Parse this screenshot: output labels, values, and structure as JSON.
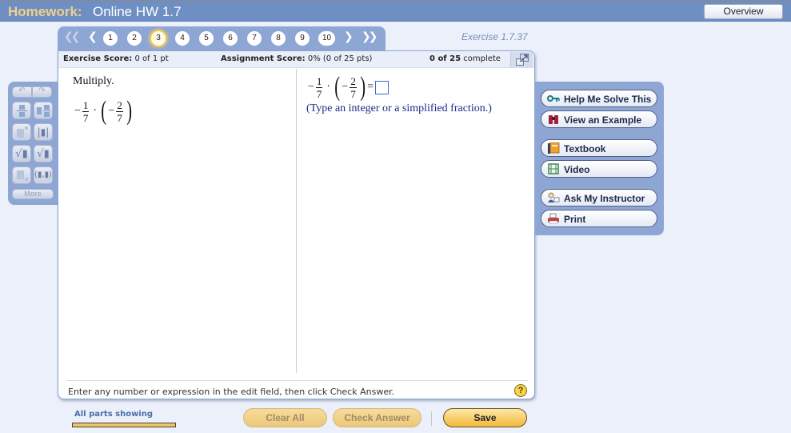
{
  "header": {
    "section_label": "Homework:",
    "assignment_title": "Online HW 1.7",
    "overview_button": "Overview"
  },
  "exercise_label": "Exercise 1.7.37",
  "navigation": {
    "first_icon": "double-chevron-left-icon",
    "prev_icon": "chevron-left-icon",
    "next_icon": "chevron-right-icon",
    "last_icon": "double-chevron-right-icon",
    "question_numbers": [
      "1",
      "2",
      "3",
      "4",
      "5",
      "6",
      "7",
      "8",
      "9",
      "10"
    ],
    "current_question": "3",
    "first_glyph": "❮❮",
    "prev_glyph": "❮",
    "next_glyph": "❯",
    "last_glyph": "❯❯"
  },
  "scores": {
    "exercise_label": "Exercise Score:",
    "exercise_value": "0 of 1 pt",
    "assignment_label": "Assignment Score:",
    "assignment_value": "0% (0 of 25 pts)",
    "complete_count": "0 of 25",
    "complete_label": "complete"
  },
  "question": {
    "prompt": "Multiply.",
    "expression": {
      "minus1": "−",
      "frac1_num": "1",
      "frac1_den": "7",
      "dot": "·",
      "lparen": "(",
      "minus2": "−",
      "frac2_num": "2",
      "frac2_den": "7",
      "rparen": ")"
    },
    "equals": "=",
    "answer_value": "",
    "answer_hint": "(Type an integer or a simplified fraction.)"
  },
  "instructions": "Enter any number or expression in the edit field, then click Check Answer.",
  "help_glyph": "?",
  "palette": {
    "undo_glyph": "↶",
    "redo_glyph": "↷",
    "buttons": [
      {
        "name": "fraction-template",
        "glyph": "▭"
      },
      {
        "name": "mixed-number-template",
        "glyph": "▭"
      },
      {
        "name": "exponent-template",
        "glyph": "▪"
      },
      {
        "name": "absolute-value-template",
        "glyph": "|▪|"
      },
      {
        "name": "square-root-template",
        "glyph": "√▪"
      },
      {
        "name": "nth-root-template",
        "glyph": "ⁿ√"
      },
      {
        "name": "subscript-template",
        "glyph": "▪"
      },
      {
        "name": "ordered-pair-template",
        "glyph": "(▪,▪)"
      }
    ],
    "more_label": "More"
  },
  "tools": [
    {
      "label": "Help Me Solve This",
      "icon": "key-icon"
    },
    {
      "label": "View an Example",
      "icon": "binoculars-icon"
    },
    {
      "label": "Textbook",
      "icon": "book-icon"
    },
    {
      "label": "Video",
      "icon": "film-icon"
    },
    {
      "label": "Ask My Instructor",
      "icon": "instructor-icon"
    },
    {
      "label": "Print",
      "icon": "printer-icon"
    }
  ],
  "footer": {
    "parts_label": "All parts showing",
    "parts_progress": 1.0,
    "clear_all": "Clear All",
    "check_answer": "Check Answer",
    "save": "Save"
  },
  "colors": {
    "header_bg": "#6e8fc4",
    "header_label": "#f3d089",
    "panel_blue": "#8ea6d4",
    "page_bg": "#ebf0fb",
    "save_button": "#f3b93a",
    "hint_text": "#1e2a8a"
  }
}
